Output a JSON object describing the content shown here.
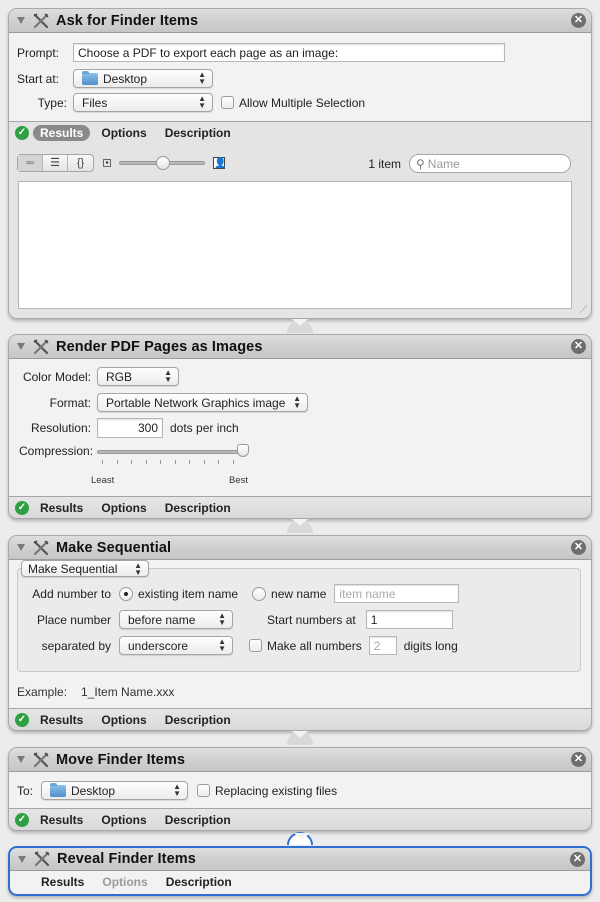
{
  "actions": [
    {
      "title": "Ask for Finder Items",
      "prompt_label": "Prompt:",
      "prompt_value": "Choose a PDF to export each page as an image:",
      "start_at_label": "Start at:",
      "start_at_value": "Desktop",
      "type_label": "Type:",
      "type_value": "Files",
      "allow_multiple_label": "Allow Multiple Selection",
      "allow_multiple_checked": false,
      "footer": {
        "results": "Results",
        "options": "Options",
        "description": "Description",
        "active_tab": "Results",
        "status": "success"
      },
      "results_view": {
        "view_modes": [
          "icon-view",
          "list-view",
          "code-view"
        ],
        "selected_view": "icon-view",
        "zoom_level": 0.45,
        "item_count": "1 item",
        "search_placeholder": "Name"
      }
    },
    {
      "title": "Render PDF Pages as Images",
      "color_model_label": "Color Model:",
      "color_model_value": "RGB",
      "format_label": "Format:",
      "format_value": "Portable Network Graphics image",
      "resolution_label": "Resolution:",
      "resolution_value": "300",
      "resolution_unit": "dots per inch",
      "compression_label": "Compression:",
      "compression_min_label": "Least",
      "compression_max_label": "Best",
      "compression_value": 1.0,
      "footer": {
        "results": "Results",
        "options": "Options",
        "description": "Description",
        "status": "success"
      }
    },
    {
      "title": "Make Sequential",
      "mode_value": "Make Sequential",
      "add_number_label": "Add number to",
      "existing_item_name_label": "existing item name",
      "existing_item_name_selected": true,
      "new_name_label": "new name",
      "new_name_placeholder": "item name",
      "place_number_label": "Place number",
      "place_number_value": "before name",
      "start_numbers_label": "Start numbers at",
      "start_numbers_value": "1",
      "separated_by_label": "separated by",
      "separated_by_value": "underscore",
      "make_all_numbers_label": "Make all numbers",
      "make_all_numbers_checked": false,
      "digits_value": "2",
      "digits_long_label": "digits long",
      "example_label": "Example:",
      "example_value": "1_Item Name.xxx",
      "footer": {
        "results": "Results",
        "options": "Options",
        "description": "Description",
        "status": "success"
      }
    },
    {
      "title": "Move Finder Items",
      "to_label": "To:",
      "to_value": "Desktop",
      "replacing_label": "Replacing existing files",
      "replacing_checked": false,
      "footer": {
        "results": "Results",
        "options": "Options",
        "description": "Description",
        "status": "success"
      }
    },
    {
      "title": "Reveal Finder Items",
      "selected": true,
      "footer": {
        "results": "Results",
        "options": "Options",
        "description": "Description",
        "options_disabled": true
      }
    }
  ],
  "colors": {
    "selection_border": "#2f6fd4",
    "success_green": "#2ea043",
    "pane_background": "#f2f2f2"
  }
}
